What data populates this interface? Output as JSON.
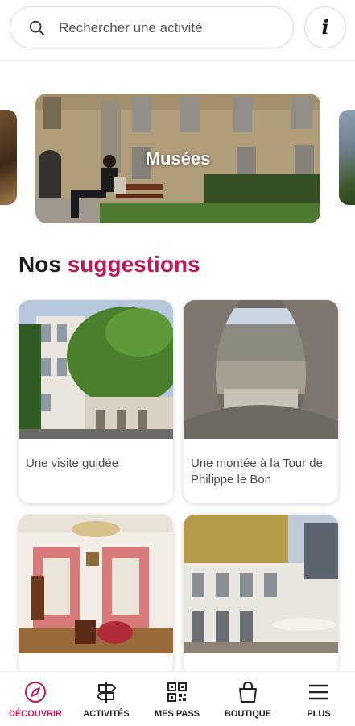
{
  "header": {
    "search_placeholder": "Rechercher une activité",
    "search_icon": "search-icon",
    "info_label": "i"
  },
  "carousel": {
    "main_label": "Musées"
  },
  "suggestions": {
    "title_plain": "Nos",
    "title_accent": "suggestions",
    "accent_color": "#c2185b",
    "cards": [
      {
        "caption": "Une visite guidée"
      },
      {
        "caption": "Une montée à la Tour de Philippe le Bon"
      },
      {
        "caption": ""
      },
      {
        "caption": ""
      }
    ]
  },
  "bottom_nav": {
    "active_color": "#c2185b",
    "items": [
      {
        "label": "DÉCOUVRIR",
        "icon": "compass-icon",
        "active": true
      },
      {
        "label": "ACTIVITÉS",
        "icon": "signpost-icon",
        "active": false
      },
      {
        "label": "MES PASS",
        "icon": "qr-code-icon",
        "active": false
      },
      {
        "label": "BOUTIQUE",
        "icon": "shopping-bag-icon",
        "active": false
      },
      {
        "label": "PLUS",
        "icon": "menu-icon",
        "active": false
      }
    ]
  }
}
